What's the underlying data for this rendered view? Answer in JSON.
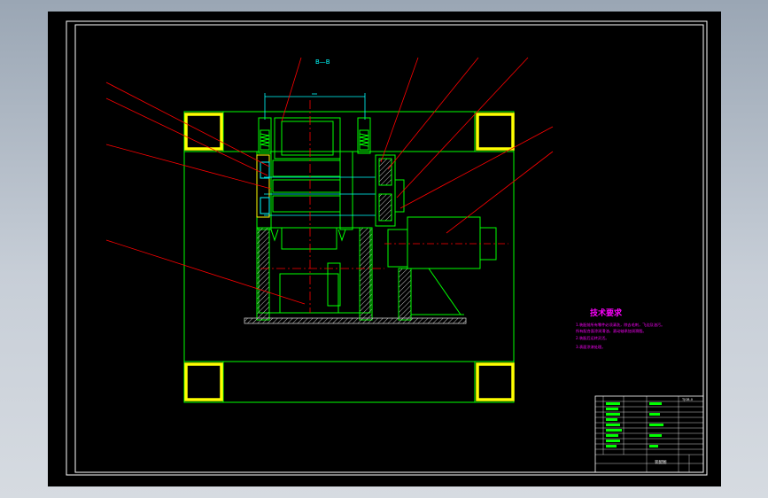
{
  "drawing": {
    "section_label": "B—B",
    "colors": {
      "background": "#000000",
      "frame": "#ffffff",
      "outline": "#00ff00",
      "leader": "#ff0000",
      "dimension": "#00ffff",
      "accent": "#ffff00",
      "notes": "#ff00ff",
      "hatch": "#c8c8c8"
    }
  },
  "notes": {
    "title": "技术要求",
    "lines": [
      "1.装配前所有零件必须清洗，除去毛刺，飞边及油污。",
      "   所有配合面涂润滑油，滚动轴承加润滑脂。",
      "2.装配后运转灵活。",
      "3.表面涂漆处理。"
    ]
  },
  "title_block": {
    "drawing_no": "TJGB-0",
    "assembly_name": "装配图"
  }
}
